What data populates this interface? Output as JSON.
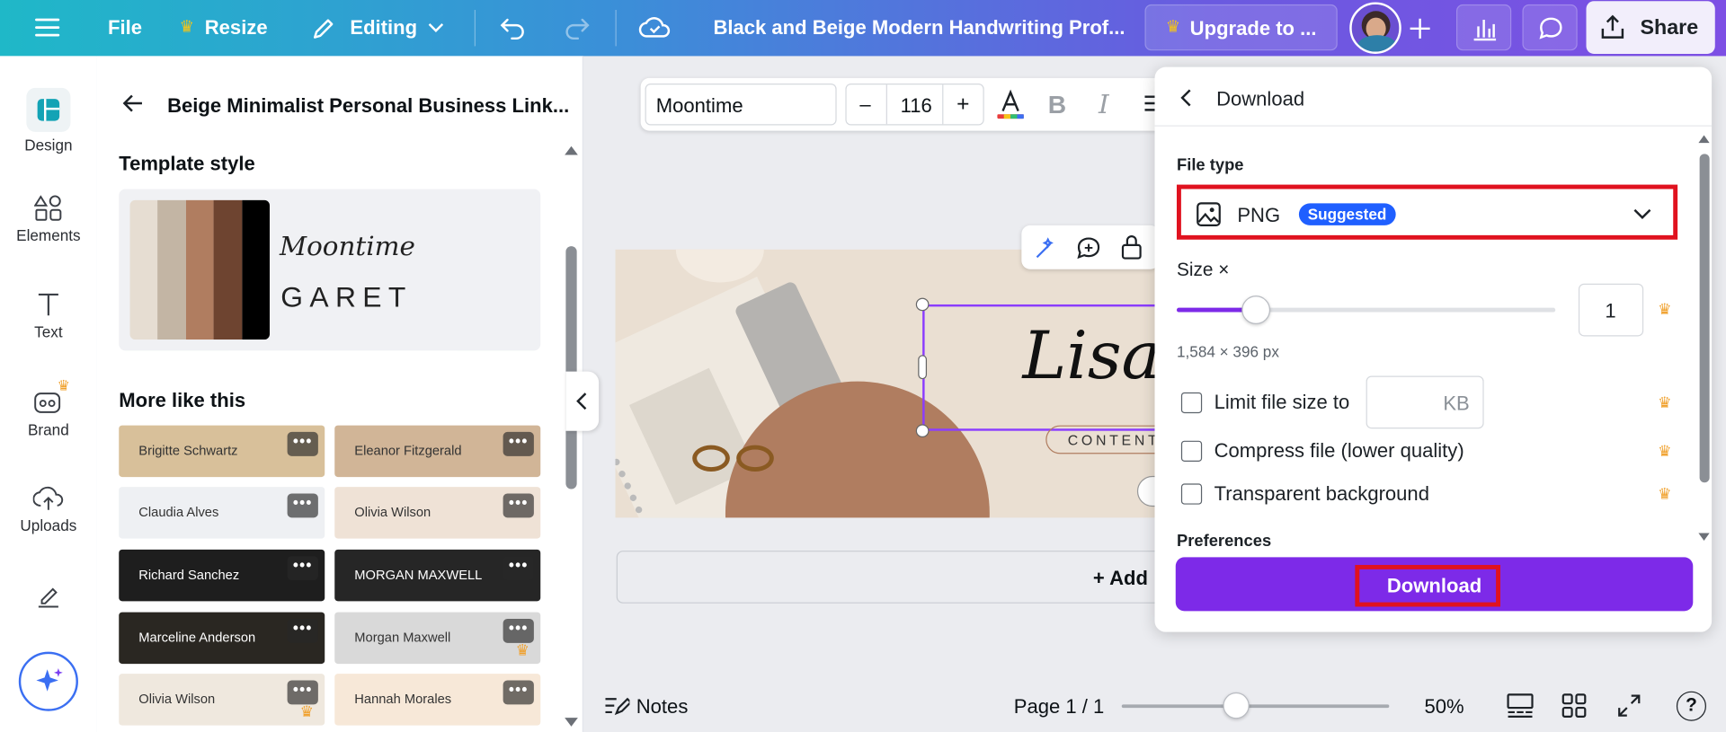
{
  "topbar": {
    "file_label": "File",
    "resize_label": "Resize",
    "editing_label": "Editing",
    "doc_title": "Black and Beige Modern Handwriting Prof...",
    "upgrade_label": "Upgrade to ...",
    "share_label": "Share"
  },
  "rail": {
    "items": [
      {
        "label": "Design"
      },
      {
        "label": "Elements"
      },
      {
        "label": "Text"
      },
      {
        "label": "Brand"
      },
      {
        "label": "Uploads"
      }
    ]
  },
  "panel": {
    "title": "Beige Minimalist Personal Business Link...",
    "template_style_heading": "Template style",
    "style_font_script": "Moontime",
    "style_font_caps": "GARET",
    "palette": [
      "#e6ddd2",
      "#c3b5a4",
      "#b07d60",
      "#6e4430",
      "#000000"
    ],
    "more_heading": "More like this",
    "templates": [
      {
        "text": "Brigitte Schwartz",
        "bg": "#d8c09a"
      },
      {
        "text": "Eleanor Fitzgerald",
        "bg": "#d1b597"
      },
      {
        "text": "Claudia Alves",
        "bg": "#eef0f3"
      },
      {
        "text": "Olivia Wilson",
        "bg": "#efe2d6"
      },
      {
        "text": "Richard Sanchez",
        "bg": "#1e1e1e"
      },
      {
        "text": "MORGAN MAXWELL",
        "bg": "#262626"
      },
      {
        "text": "Marceline Anderson",
        "bg": "#2a2722"
      },
      {
        "text": "Morgan Maxwell",
        "bg": "#d9d9d9"
      },
      {
        "text": "Olivia Wilson",
        "bg": "#efe8de"
      },
      {
        "text": "Hannah Morales",
        "bg": "#f7e8d8"
      }
    ]
  },
  "format_toolbar": {
    "font_name": "Moontime",
    "font_size": "116",
    "minus": "–",
    "plus": "+"
  },
  "canvas": {
    "name_text": "Lisa",
    "subtitle_text": "CONTENT",
    "add_page_label": "+ Add"
  },
  "download": {
    "header": "Download",
    "file_type_label": "File type",
    "file_type_value": "PNG",
    "suggested_badge": "Suggested",
    "size_label": "Size ×",
    "size_value": "1",
    "size_fraction": 0.21,
    "dimensions": "1,584 × 396 px",
    "limit_label": "Limit file size to",
    "limit_unit": "KB",
    "compress_label": "Compress file (lower quality)",
    "transparent_label": "Transparent background",
    "preferences_label": "Preferences",
    "download_button": "Download"
  },
  "bottombar": {
    "notes_label": "Notes",
    "page_label": "Page 1 / 1",
    "zoom_label": "50%",
    "zoom_fraction": 0.43
  },
  "colors": {
    "accent_purple": "#7d2ae8",
    "highlight_red": "#e0121f",
    "suggested_blue": "#1f5fff",
    "crown": "#f0a02b"
  }
}
